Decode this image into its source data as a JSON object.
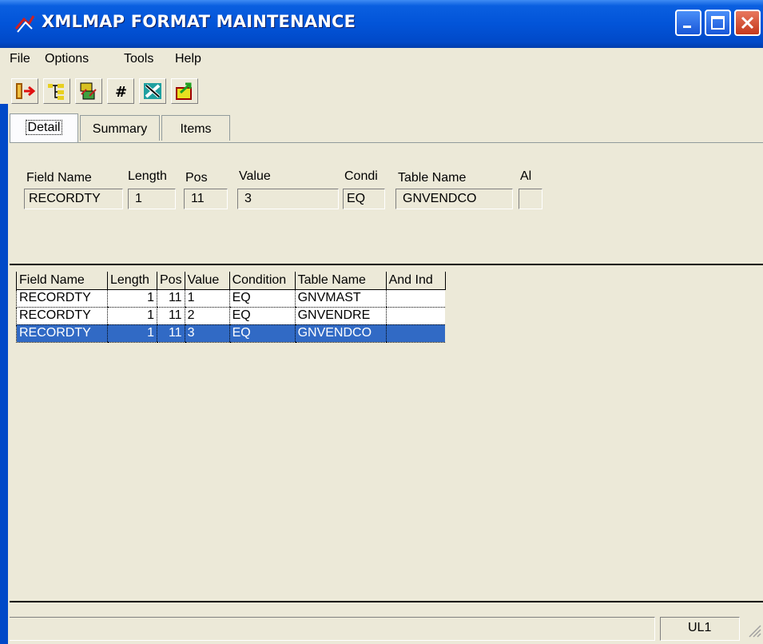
{
  "window": {
    "title": "XMLMAP FORMAT MAINTENANCE"
  },
  "menu": [
    "File",
    "Options",
    "Tools",
    "Help"
  ],
  "toolbar": {
    "buttons": [
      "exit-icon",
      "tree-icon",
      "tree-edit-icon",
      "hash-icon",
      "tools-icon",
      "export-icon"
    ]
  },
  "tabs": [
    {
      "label": "Detail",
      "underline": "D",
      "active": true
    },
    {
      "label": "Summary",
      "underline": "S",
      "active": false
    },
    {
      "label": "Items",
      "underline": "I",
      "active": false
    }
  ],
  "detail": {
    "labels": {
      "field_name": "Field Name",
      "length": "Length",
      "pos": "Pos",
      "value": "Value",
      "condition": "Condi",
      "table_name": "Table Name",
      "and_ind": "Al"
    },
    "values": {
      "field_name": "RECORDTY",
      "length": "1",
      "pos": "11",
      "value": "3",
      "condition": "EQ",
      "table_name": "GNVENDCO",
      "and_ind": ""
    }
  },
  "grid": {
    "columns": [
      "Field Name",
      "Length",
      "Pos",
      "Value",
      "Condition",
      "Table Name",
      "And Ind"
    ],
    "rows": [
      {
        "field_name": "RECORDTY",
        "length": "1",
        "pos": "11",
        "value": "1",
        "condition": "EQ",
        "table_name": "GNVMAST",
        "and_ind": ""
      },
      {
        "field_name": "RECORDTY",
        "length": "1",
        "pos": "11",
        "value": "2",
        "condition": "EQ",
        "table_name": "GNVENDRE",
        "and_ind": ""
      },
      {
        "field_name": "RECORDTY",
        "length": "1",
        "pos": "11",
        "value": "3",
        "condition": "EQ",
        "table_name": "GNVENDCO",
        "and_ind": "",
        "selected": true
      }
    ]
  },
  "status": {
    "panel": "UL1"
  },
  "colors": {
    "titlebar": "#0254d8",
    "selection": "#316ac5",
    "face": "#ece9d8"
  }
}
